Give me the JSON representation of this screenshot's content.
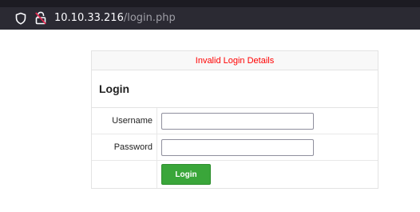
{
  "browser": {
    "url_host": "10.10.33.216",
    "url_path": "/login.php",
    "shield_icon": "shield-icon",
    "lock_icon": "insecure-lock-icon"
  },
  "login": {
    "error_message": "Invalid Login Details",
    "heading": "Login",
    "username_label": "Username",
    "username_value": "",
    "password_label": "Password",
    "password_value": "",
    "submit_label": "Login",
    "colors": {
      "error": "#ff0000",
      "submit_button": "#3aa63a"
    }
  }
}
